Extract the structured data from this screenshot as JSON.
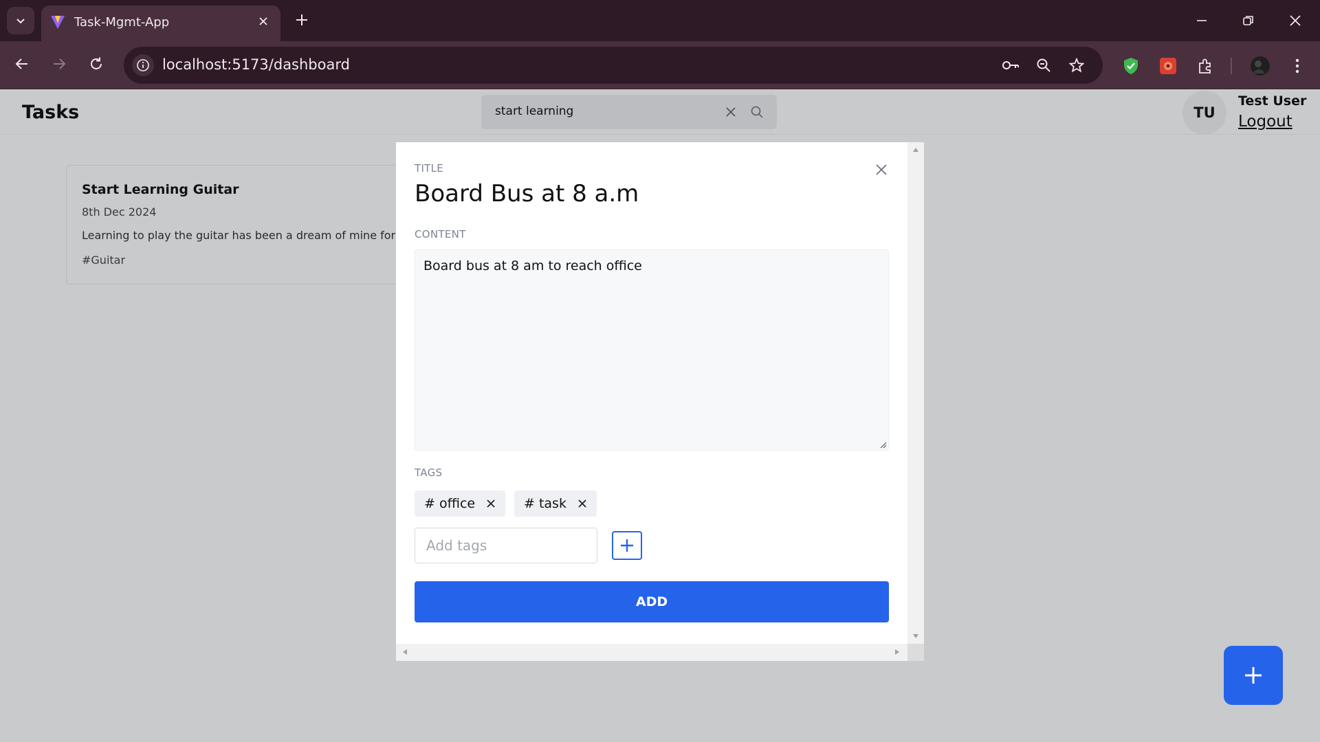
{
  "browser": {
    "tab_title": "Task-Mgmt-App",
    "url": "localhost:5173/dashboard"
  },
  "header": {
    "title": "Tasks",
    "search_value": "start learning",
    "user_initials": "TU",
    "user_name": "Test User",
    "logout_label": "Logout"
  },
  "card": {
    "title": "Start Learning Guitar",
    "date": "8th Dec 2024",
    "content": "Learning to play the guitar has been a dream of mine for",
    "tag": "#Guitar"
  },
  "modal": {
    "title_label": "TITLE",
    "title_value": "Board Bus at 8 a.m",
    "content_label": "CONTENT",
    "content_value": "Board bus at 8 am to reach office",
    "tags_label": "TAGS",
    "tags": [
      "# office",
      "# task"
    ],
    "tag_input_placeholder": "Add tags",
    "submit_label": "ADD"
  },
  "colors": {
    "accent": "#2563eb",
    "chrome_dark": "#2e1a26",
    "chrome_toolbar": "#4a2f3f",
    "backdrop": "#c9cacc"
  }
}
